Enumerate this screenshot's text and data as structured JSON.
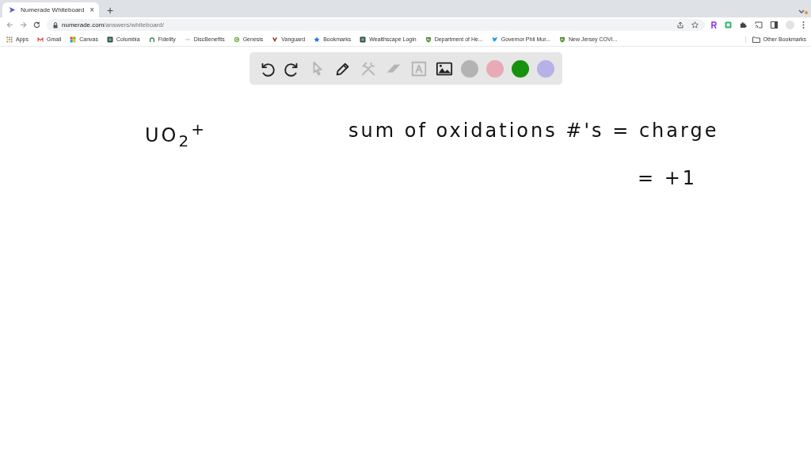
{
  "tab": {
    "title": "Numerade Whiteboard",
    "close": "×",
    "new_tab": "+"
  },
  "address_bar": {
    "domain": "numerade.com",
    "path": "/answers/whiteboard/"
  },
  "bookmarks": [
    {
      "label": "Apps",
      "kind": "grid"
    },
    {
      "label": "Gmail",
      "kind": "mail"
    },
    {
      "label": "Canvas",
      "kind": "squares"
    },
    {
      "label": "Columbia",
      "kind": "dark"
    },
    {
      "label": "Fidelity",
      "kind": "arc"
    },
    {
      "label": "DiscBenefits",
      "kind": "disc"
    },
    {
      "label": "Genesis",
      "kind": "round"
    },
    {
      "label": "Vanguard",
      "kind": "vee"
    },
    {
      "label": "Bookmarks",
      "kind": "star"
    },
    {
      "label": "Wealthscape Login",
      "kind": "dark"
    },
    {
      "label": "Department of He...",
      "kind": "shield"
    },
    {
      "label": "Governor Phil Mur...",
      "kind": "bird"
    },
    {
      "label": "New Jersey COVI...",
      "kind": "shield"
    }
  ],
  "other_bookmarks": "Other Bookmarks",
  "tools": [
    {
      "kind": "undo",
      "disabled": false
    },
    {
      "kind": "redo",
      "disabled": false
    },
    {
      "kind": "pointer",
      "disabled": true
    },
    {
      "kind": "pen",
      "disabled": false
    },
    {
      "kind": "tools",
      "disabled": true
    },
    {
      "kind": "eraser",
      "disabled": true
    },
    {
      "kind": "text",
      "disabled": true
    },
    {
      "kind": "image",
      "disabled": false
    }
  ],
  "swatches": [
    {
      "color": "#b3b3b3"
    },
    {
      "color": "#e8aab4"
    },
    {
      "color": "#17920f"
    },
    {
      "color": "#b6b1e6"
    }
  ],
  "board": [
    {
      "text": "UO$_{2}$$^{+}$"
    },
    {
      "text": "sum of oxidations #'s = charge"
    },
    {
      "text": "= +1"
    }
  ]
}
